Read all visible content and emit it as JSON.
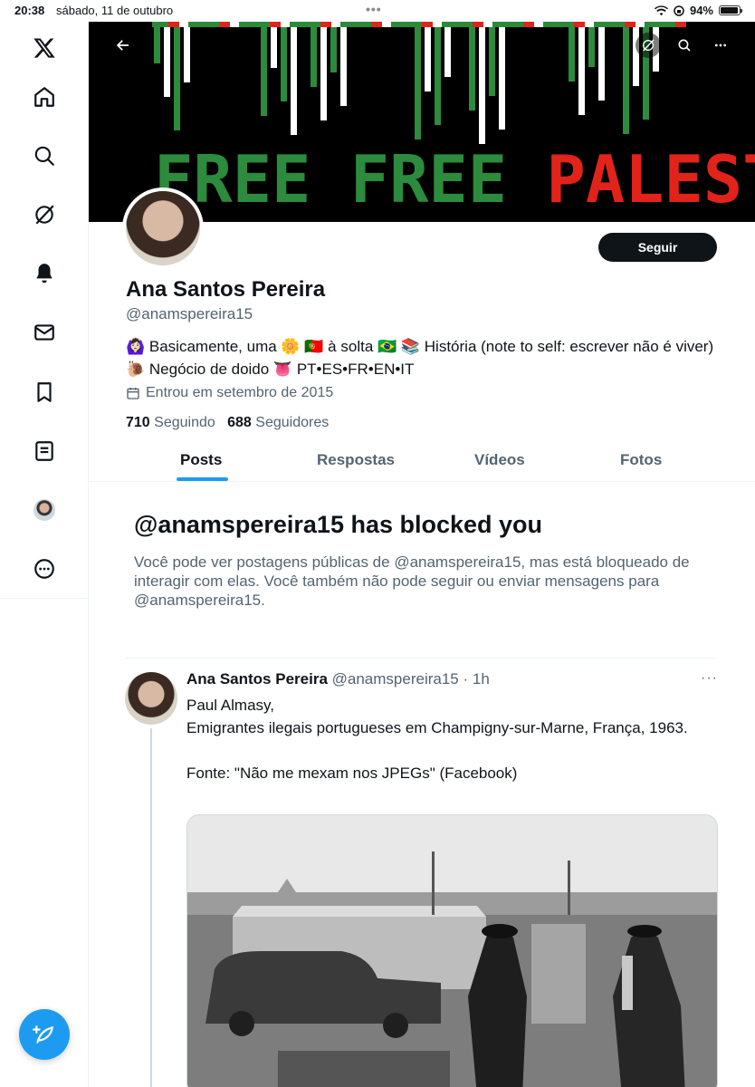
{
  "status_bar": {
    "time": "20:38",
    "date": "sábado, 11 de outubro",
    "battery": "94%",
    "battery_level": 0.94
  },
  "sidebar": {
    "items": [
      "x-logo-icon",
      "home-icon",
      "search-icon",
      "grok-icon",
      "notifications-icon",
      "messages-icon",
      "bookmarks-icon",
      "lists-icon",
      "profile-avatar",
      "more-icon"
    ]
  },
  "banner": {
    "text_green": "FREE FREE ",
    "text_red": "PALESTINE"
  },
  "profile": {
    "name": "Ana Santos Pereira",
    "handle": "@anamspereira15",
    "follow_label": "Seguir",
    "bio": "🙆🏻‍♀️ Basicamente, uma 🌼 🇵🇹 à solta 🇧🇷 📚 História (note to self: escrever não é viver) 🐌 Negócio de doido 👅 PT•ES•FR•EN•IT",
    "joined": "Entrou em setembro de 2015",
    "following_count": "710",
    "following_label": "Seguindo",
    "followers_count": "688",
    "followers_label": "Seguidores"
  },
  "tabs": [
    "Posts",
    "Respostas",
    "Vídeos",
    "Fotos"
  ],
  "blocked": {
    "title": "@anamspereira15 has blocked you",
    "message": "Você pode ver postagens públicas de @anamspereira15, mas está bloqueado de interagir com elas. Você também não pode seguir ou enviar mensagens para @anamspereira15."
  },
  "post": {
    "author": "Ana Santos Pereira",
    "handle": "@anamspereira15",
    "time": "· 1h",
    "more": "···",
    "text": "Paul Almasy,\nEmigrantes ilegais portugueses em Champigny-sur-Marne, França, 1963.\n\nFonte: \"Não me mexam nos JPEGs\" (Facebook)"
  },
  "colors": {
    "accent": "#1d9bf0",
    "text": "#0f1419",
    "muted": "#536471",
    "green": "#2c8b3c",
    "red": "#e2231a"
  }
}
